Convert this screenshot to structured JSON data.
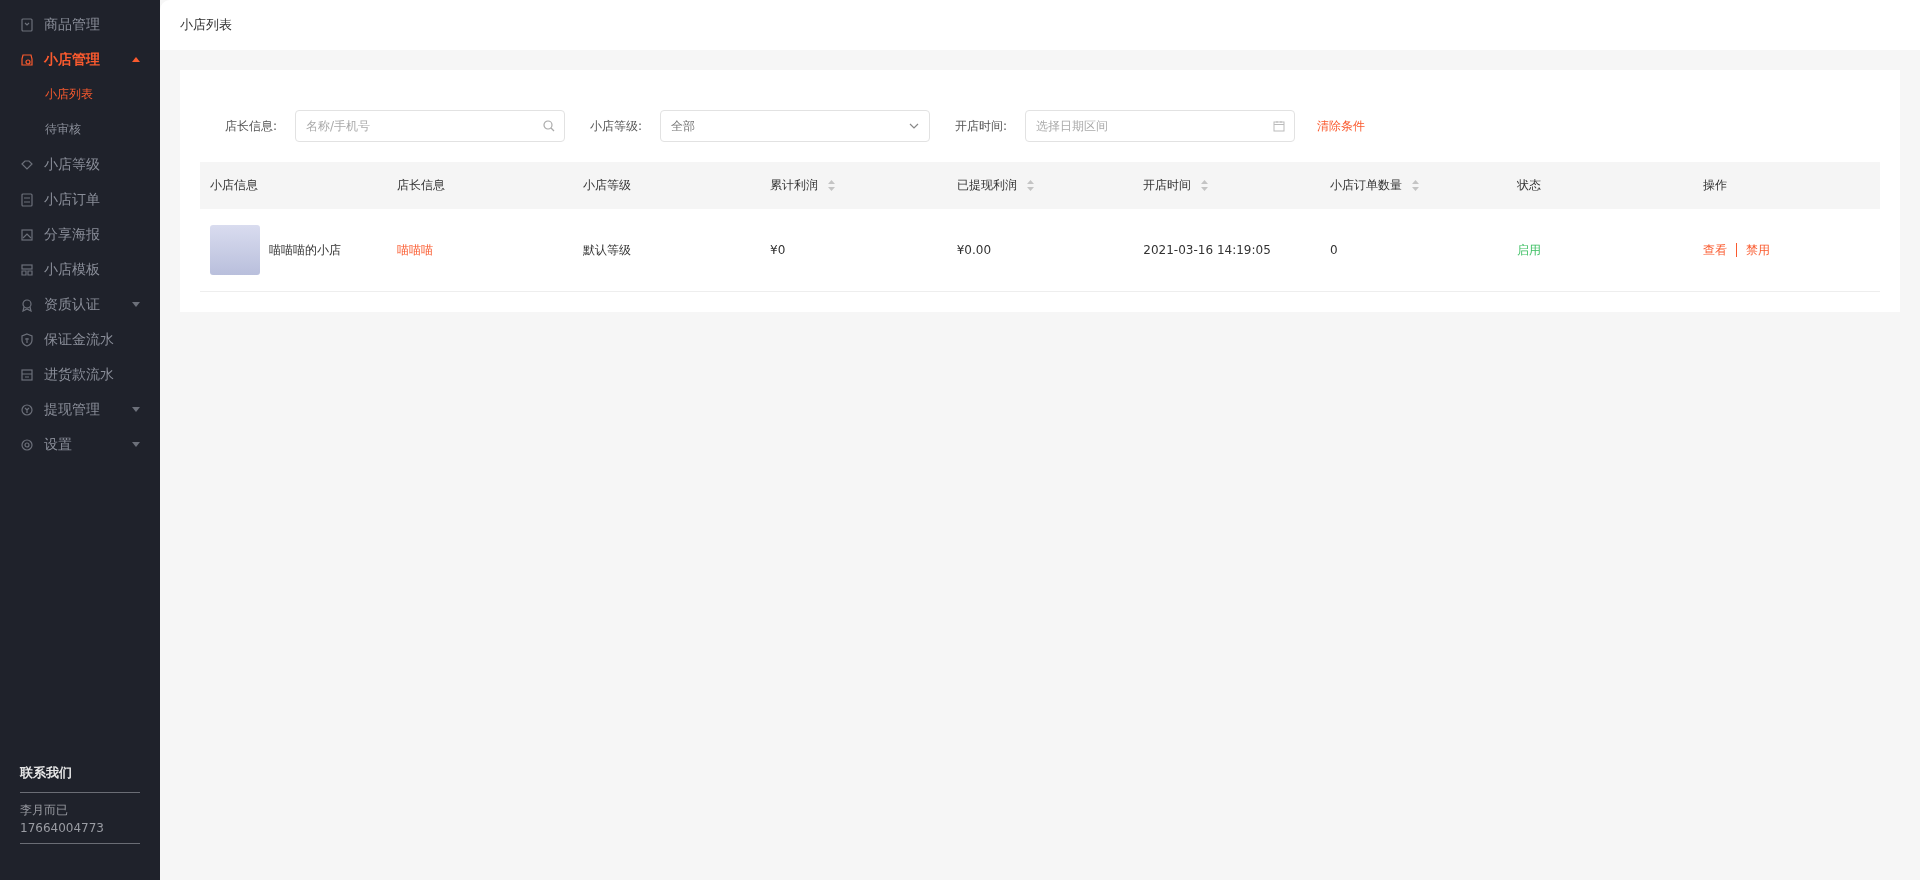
{
  "sidebar": {
    "items": [
      {
        "label": "商品管理",
        "selected": false
      },
      {
        "label": "小店管理",
        "selected": true,
        "expanded": true,
        "children": [
          {
            "label": "小店列表",
            "selected": true
          },
          {
            "label": "待审核",
            "selected": false
          }
        ]
      },
      {
        "label": "小店等级",
        "selected": false
      },
      {
        "label": "小店订单",
        "selected": false
      },
      {
        "label": "分享海报",
        "selected": false
      },
      {
        "label": "小店模板",
        "selected": false
      },
      {
        "label": "资质认证",
        "selected": false,
        "expanded": false
      },
      {
        "label": "保证金流水",
        "selected": false
      },
      {
        "label": "进货款流水",
        "selected": false
      },
      {
        "label": "提现管理",
        "selected": false,
        "expanded": false
      },
      {
        "label": "设置",
        "selected": false,
        "expanded": false
      }
    ],
    "contact": {
      "title": "联系我们",
      "name": "李月而已",
      "phone": "17664004773"
    }
  },
  "header": {
    "title": "小店列表"
  },
  "filters": [
    {
      "label": "店长信息:",
      "kind": "search",
      "placeholder": "名称/手机号"
    },
    {
      "label": "小店等级:",
      "kind": "select",
      "value": "全部"
    },
    {
      "label": "开店时间:",
      "kind": "date",
      "placeholder": "选择日期区间"
    }
  ],
  "clear_button": "清除条件",
  "table": {
    "columns": [
      {
        "label": "小店信息",
        "sortable": false
      },
      {
        "label": "店长信息",
        "sortable": false
      },
      {
        "label": "小店等级",
        "sortable": false
      },
      {
        "label": "累计利润",
        "sortable": true
      },
      {
        "label": "已提现利润",
        "sortable": true
      },
      {
        "label": "开店时间",
        "sortable": true
      },
      {
        "label": "小店订单数量",
        "sortable": true
      },
      {
        "label": "状态",
        "sortable": false
      },
      {
        "label": "操作",
        "sortable": false
      }
    ],
    "rows": [
      {
        "shop": "喵喵喵的小店",
        "owner": "喵喵喵",
        "level": "默认等级",
        "profit": "¥0",
        "withdrawn": "¥0.00",
        "opened": "2021-03-16 14:19:05",
        "orders": "0",
        "status": "启用",
        "enabled": true,
        "actions": [
          "查看",
          "禁用"
        ]
      }
    ]
  }
}
